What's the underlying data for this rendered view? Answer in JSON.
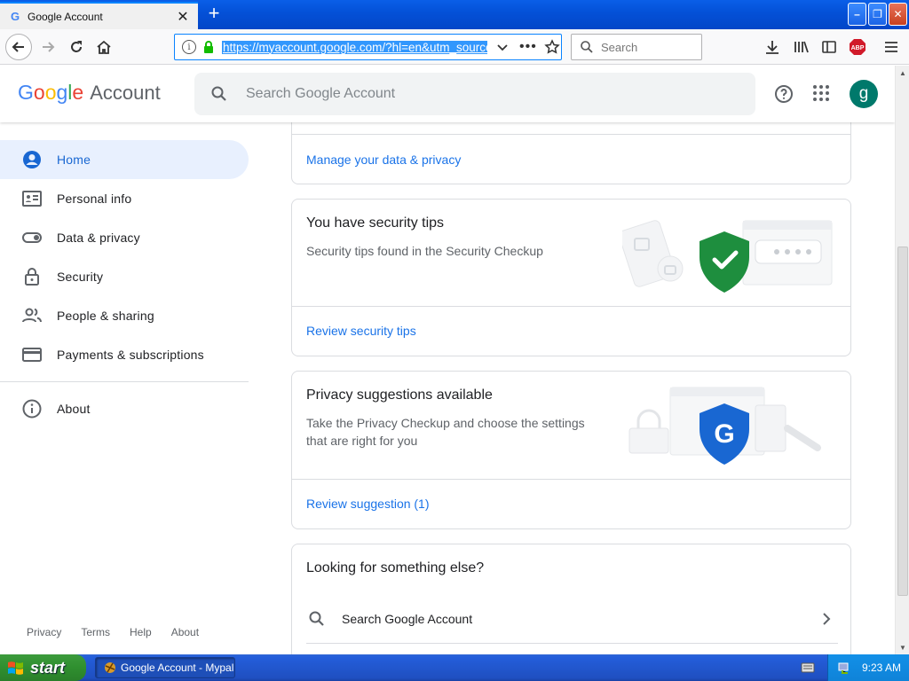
{
  "browser": {
    "tab_title": "Google Account",
    "tab_favicon": "G",
    "new_tab": "+",
    "url": "https://myaccount.google.com/?hl=en&utm_source=",
    "search_placeholder": "Search",
    "url_more": "•••"
  },
  "header": {
    "logo_letters": [
      "G",
      "o",
      "o",
      "g",
      "l",
      "e"
    ],
    "logo_word": "Account",
    "search_placeholder": "Search Google Account",
    "avatar_letter": "g"
  },
  "sidebar": {
    "items": [
      {
        "label": "Home",
        "icon": "account-circle-icon",
        "active": true
      },
      {
        "label": "Personal info",
        "icon": "id-card-icon"
      },
      {
        "label": "Data & privacy",
        "icon": "toggle-icon"
      },
      {
        "label": "Security",
        "icon": "lock-icon"
      },
      {
        "label": "People & sharing",
        "icon": "people-icon"
      },
      {
        "label": "Payments & subscriptions",
        "icon": "credit-card-icon"
      }
    ],
    "about": {
      "label": "About",
      "icon": "info-icon"
    },
    "footer": [
      "Privacy",
      "Terms",
      "Help",
      "About"
    ]
  },
  "cards": {
    "data_privacy_link": "Manage your data & privacy",
    "security": {
      "title": "You have security tips",
      "desc": "Security tips found in the Security Checkup",
      "link": "Review security tips",
      "colors": {
        "shield": "#1e8e3e"
      }
    },
    "privacy": {
      "title": "Privacy suggestions available",
      "desc": "Take the Privacy Checkup and choose the settings that are right for you",
      "link": "Review suggestion (1)",
      "colors": {
        "shield": "#1967d2"
      }
    },
    "else": {
      "title": "Looking for something else?",
      "search_row": "Search Google Account"
    }
  },
  "taskbar": {
    "start": "start",
    "task": "Google Account - Mypal",
    "clock": "9:23 AM"
  },
  "colors": {
    "accent_blue": "#1a73e8",
    "xp_taskbar": "#245edb",
    "xp_start": "#2f8f2f"
  }
}
